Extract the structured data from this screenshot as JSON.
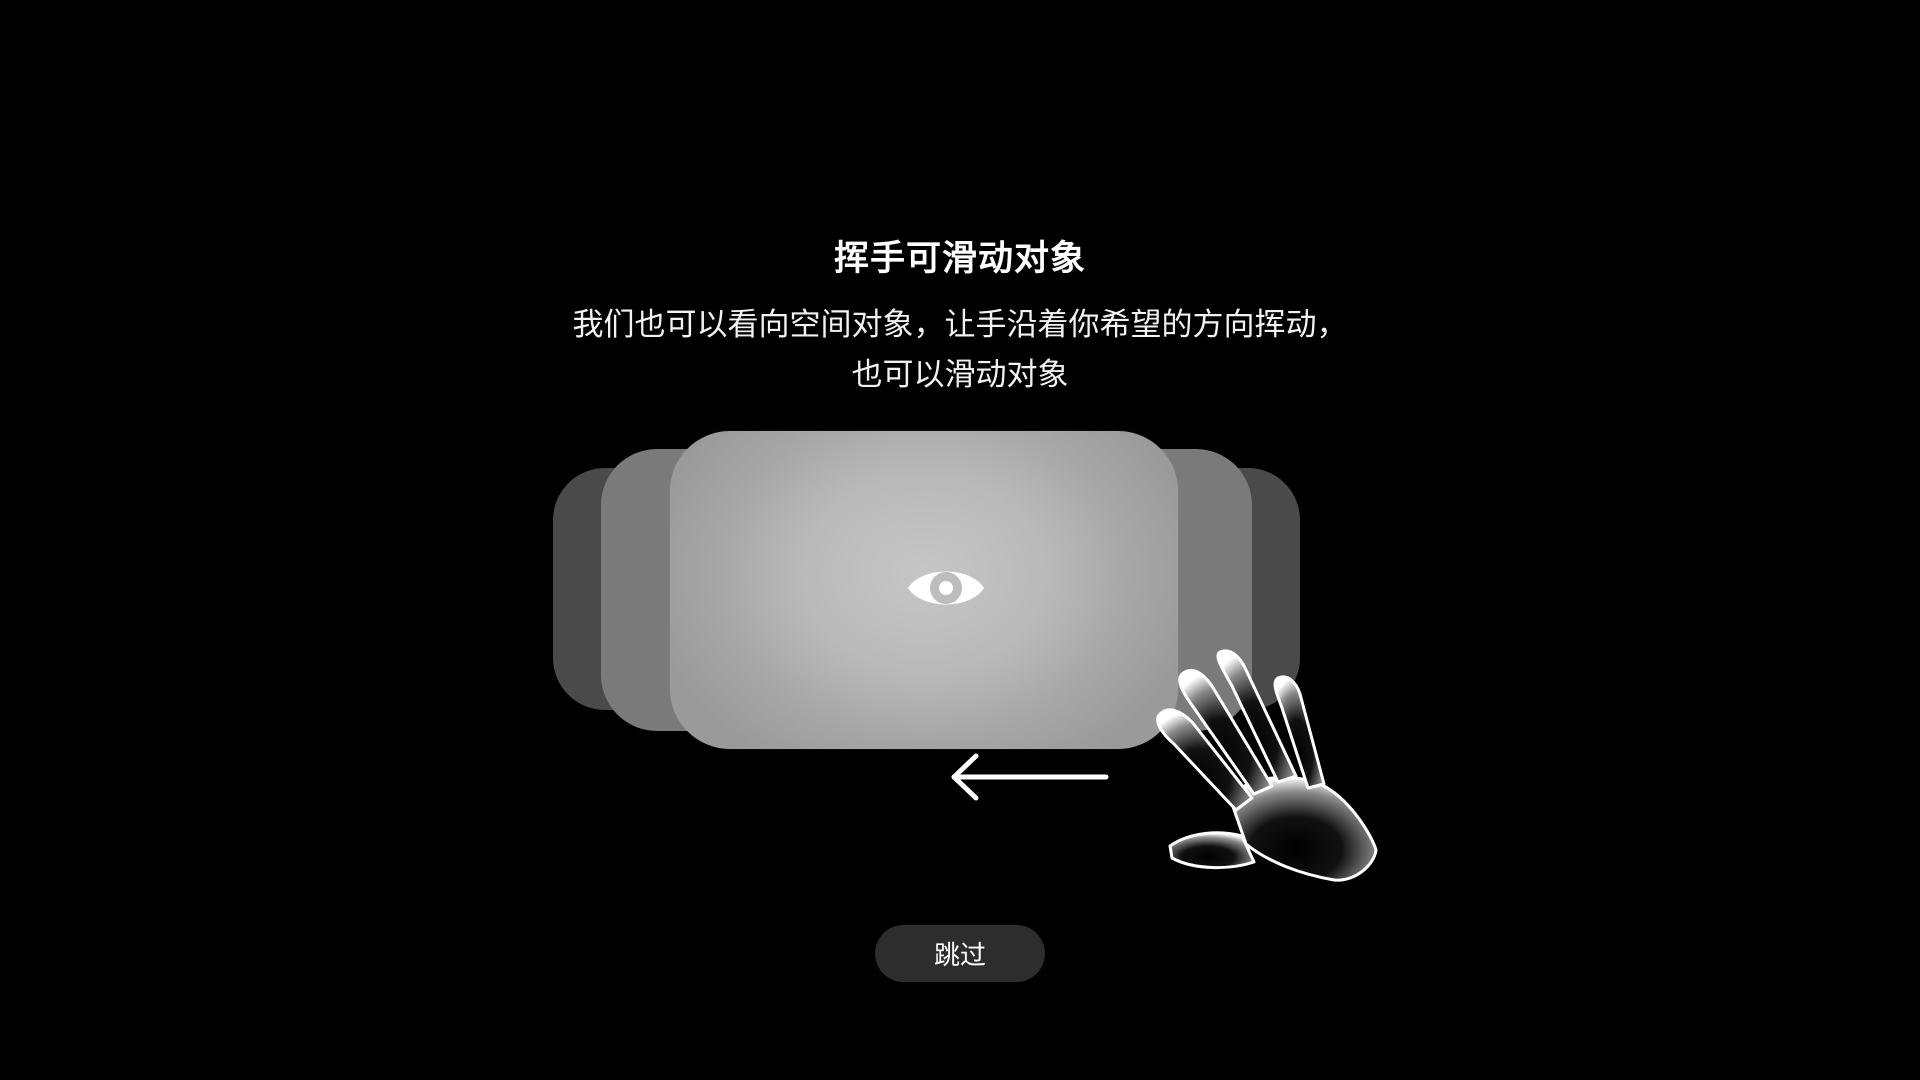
{
  "tutorial": {
    "title": "挥手可滑动对象",
    "description_line1": "我们也可以看向空间对象，让手沿着你希望的方向挥动，",
    "description_line2": "也可以滑动对象"
  },
  "illustration": {
    "icons": [
      "eye-icon",
      "left-arrow-icon",
      "hand-icon"
    ]
  },
  "actions": {
    "skip_label": "跳过"
  },
  "colors": {
    "background": "#000000",
    "skip_button_bg": "#2d2d2d",
    "text": "#ffffff"
  }
}
